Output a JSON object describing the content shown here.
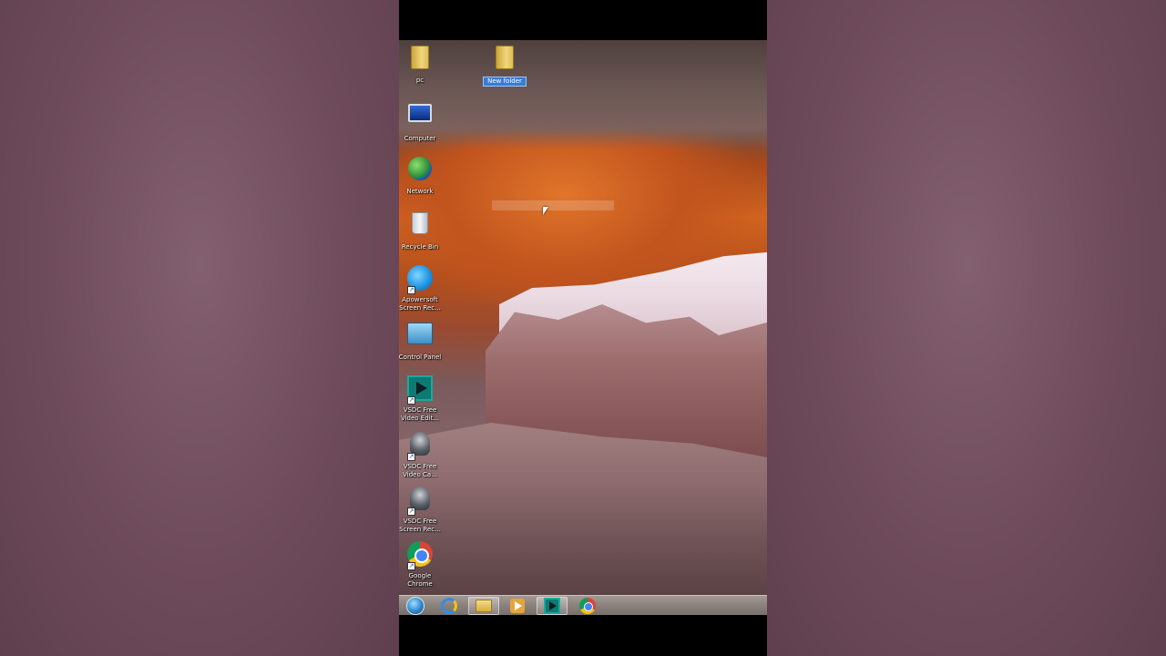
{
  "desktop": {
    "icons": [
      {
        "label": "pc",
        "icon": "folder-icon"
      },
      {
        "label": "New folder",
        "icon": "folder-icon",
        "selected": true
      },
      {
        "label": "Computer",
        "icon": "computer-icon"
      },
      {
        "label": "Network",
        "icon": "network-icon"
      },
      {
        "label": "Recycle Bin",
        "icon": "recycle-bin-icon"
      },
      {
        "label": "Apowersoft Screen Rec...",
        "icon": "apowersoft-icon"
      },
      {
        "label": "Control Panel",
        "icon": "control-panel-icon"
      },
      {
        "label": "VSDC Free Video Edit...",
        "icon": "vsdc-editor-icon"
      },
      {
        "label": "VSDC Free Video Ca...",
        "icon": "vsdc-capture-icon"
      },
      {
        "label": "VSDC Free Screen Rec...",
        "icon": "vsdc-screen-icon"
      },
      {
        "label": "Google Chrome",
        "icon": "chrome-icon"
      }
    ]
  },
  "taskbar": {
    "items": [
      {
        "icon": "start-orb-icon"
      },
      {
        "icon": "internet-explorer-icon"
      },
      {
        "icon": "file-explorer-icon",
        "active": true
      },
      {
        "icon": "media-player-icon"
      },
      {
        "icon": "vsdc-icon",
        "active": true
      },
      {
        "icon": "chrome-icon"
      }
    ]
  }
}
